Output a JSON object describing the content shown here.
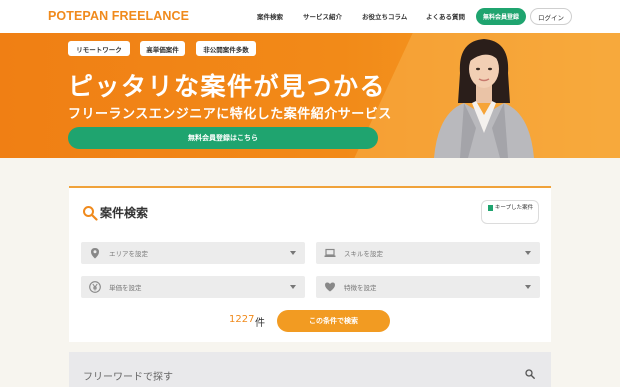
{
  "brand": {
    "logo": "POTEPAN FREELANCE",
    "accent": "#f08a1c",
    "green": "#1fa46f"
  },
  "nav": {
    "items": [
      "案件検索",
      "サービス紹介",
      "お役立ちコラム",
      "よくある質問"
    ],
    "register_label": "無料会員登録",
    "login_label": "ログイン"
  },
  "hero": {
    "tags": [
      "リモートワーク",
      "高単価案件",
      "非公開案件多数"
    ],
    "title": "ピッタリな案件が見つかる",
    "subtitle": "フリーランスエンジニアに特化した案件紹介サービス",
    "cta_label": "無料会員登録はこちら"
  },
  "search": {
    "title": "案件検索",
    "keep_label": "キープした案件",
    "filters": {
      "area": {
        "placeholder": "エリアを設定",
        "icon": "location-pin-icon"
      },
      "skill": {
        "placeholder": "スキルを設定",
        "icon": "laptop-icon"
      },
      "price": {
        "placeholder": "単価を設定",
        "icon": "yen-icon"
      },
      "feature": {
        "placeholder": "特徴を設定",
        "icon": "heart-icon"
      }
    },
    "result_count": "1227",
    "result_unit": "件",
    "submit_label": "この条件で検索"
  },
  "freeword": {
    "placeholder": "フリーワードで探す",
    "icon": "search-icon"
  }
}
